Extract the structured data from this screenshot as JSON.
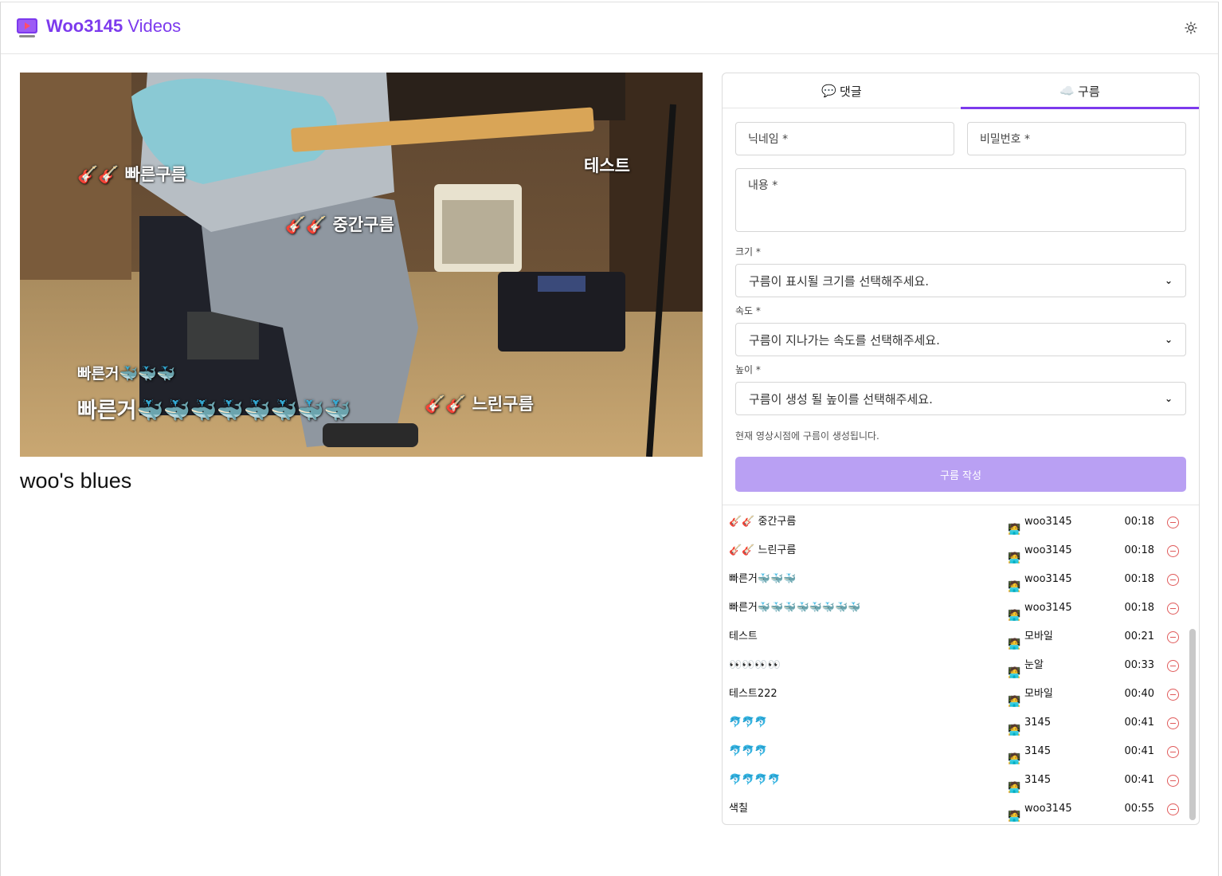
{
  "header": {
    "brand_name": "Woo3145",
    "brand_suffix": "Videos",
    "theme_icon": "sun-icon",
    "accent": "#7c3aed"
  },
  "video": {
    "title": "woo's blues",
    "clouds": [
      {
        "text": "🎸🎸 빠른구름"
      },
      {
        "text": "테스트"
      },
      {
        "text": "🎸🎸 중간구름"
      },
      {
        "text": "빠른거🐳🐳🐳"
      },
      {
        "text": "빠른거🐳🐳🐳🐳🐳🐳🐳🐳"
      },
      {
        "text": "🎸🎸 느린구름"
      }
    ]
  },
  "tabs": [
    {
      "icon": "💬",
      "label": "댓글"
    },
    {
      "icon": "☁️",
      "label": "구름"
    }
  ],
  "form": {
    "nickname_placeholder": "닉네임 *",
    "password_placeholder": "비밀번호 *",
    "content_placeholder": "내용 *",
    "size_label": "크기 *",
    "size_placeholder": "구름이 표시될 크기를 선택해주세요.",
    "speed_label": "속도 *",
    "speed_placeholder": "구름이 지나가는 속도를 선택해주세요.",
    "height_label": "높이 *",
    "height_placeholder": "구름이 생성 될 높이를 선택해주세요.",
    "hint": "현재 영상시점에 구름이 생성됩니다.",
    "submit_label": "구름 작성",
    "submit_color": "#b9a0f3"
  },
  "clouds_list": [
    {
      "text": "🎸🎸 중간구름",
      "user": "woo3145",
      "time": "00:18"
    },
    {
      "text": "🎸🎸 느린구름",
      "user": "woo3145",
      "time": "00:18"
    },
    {
      "text": "빠른거🐳🐳🐳",
      "user": "woo3145",
      "time": "00:18"
    },
    {
      "text": "빠른거🐳🐳🐳🐳🐳🐳🐳🐳",
      "user": "woo3145",
      "time": "00:18"
    },
    {
      "text": "테스트",
      "user": "모바일",
      "time": "00:21"
    },
    {
      "text": "👀👀👀👀",
      "user": "눈알",
      "time": "00:33"
    },
    {
      "text": "테스트222",
      "user": "모바일",
      "time": "00:40"
    },
    {
      "text": "🐬🐬🐬",
      "user": "3145",
      "time": "00:41"
    },
    {
      "text": "🐬🐬🐬",
      "user": "3145",
      "time": "00:41"
    },
    {
      "text": "🐬🐬🐬🐬",
      "user": "3145",
      "time": "00:41"
    },
    {
      "text": "색칠",
      "user": "woo3145",
      "time": "00:55"
    }
  ]
}
